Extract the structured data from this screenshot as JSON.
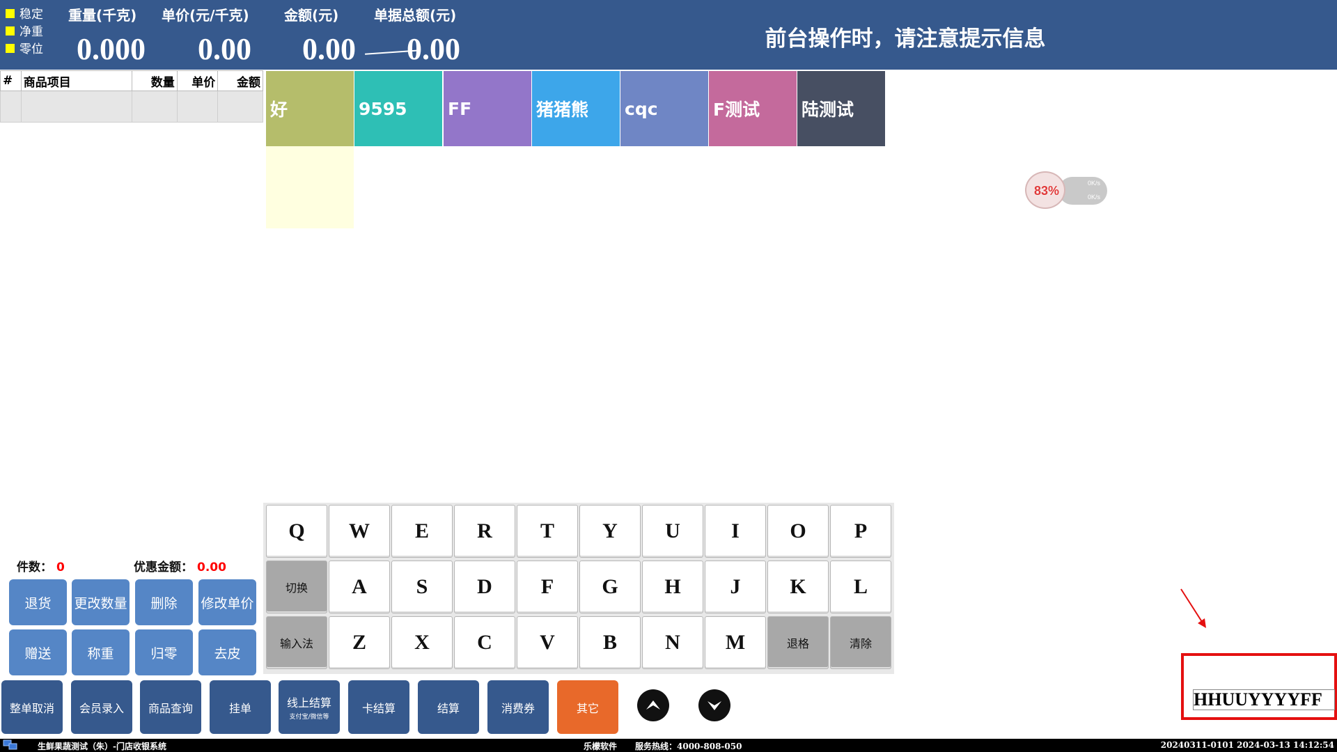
{
  "header": {
    "indicators": [
      "稳定",
      "净重",
      "零位"
    ],
    "indicator_color": "#ffff00",
    "labels": {
      "weight": "重量(千克)",
      "unit_price": "单价(元/千克)",
      "amount": "金额(元)",
      "total": "单据总额(元)"
    },
    "values": {
      "weight": "0.000",
      "unit_price": "0.00",
      "amount": "0.00",
      "total": "0.00"
    },
    "notice": "前台操作时，请注意提示信息",
    "background": "#36598d"
  },
  "order_table": {
    "columns": [
      "#",
      "商品项目",
      "数量",
      "单价",
      "金额"
    ],
    "rows": []
  },
  "categories": [
    {
      "label": "好",
      "color": "#b5bd6b"
    },
    {
      "label": "9595",
      "color": "#2ebfb5"
    },
    {
      "label": "FF",
      "color": "#9376c9"
    },
    {
      "label": "猪猪熊",
      "color": "#3da6ea"
    },
    {
      "label": "cqc",
      "color": "#6f86c5"
    },
    {
      "label": "F测试",
      "color": "#c46a9c"
    },
    {
      "label": "陆测试",
      "color": "#474f62"
    }
  ],
  "widget": {
    "percent": "83%",
    "upload": "0K/s",
    "download": "0K/s",
    "icons": [
      "cpu-ball-icon"
    ]
  },
  "keyboard": {
    "row1": [
      "Q",
      "W",
      "E",
      "R",
      "T",
      "Y",
      "U",
      "I",
      "O",
      "P"
    ],
    "row2": [
      "切换",
      "A",
      "S",
      "D",
      "F",
      "G",
      "H",
      "J",
      "K",
      "L"
    ],
    "row3": [
      "输入法",
      "Z",
      "X",
      "C",
      "V",
      "B",
      "N",
      "M",
      "退格",
      "清除"
    ]
  },
  "stats": {
    "count_label": "件数：",
    "count_value": "0",
    "discount_label": "优惠金额：",
    "discount_value": "0.00"
  },
  "function_buttons": {
    "row1": [
      "退货",
      "更改数量",
      "删除",
      "修改单价"
    ],
    "row2": [
      "赠送",
      "称重",
      "归零",
      "去皮"
    ]
  },
  "bottom_buttons": [
    {
      "label": "整单取消",
      "sub": ""
    },
    {
      "label": "会员录入",
      "sub": ""
    },
    {
      "label": "商品查询",
      "sub": ""
    },
    {
      "label": "挂单",
      "sub": ""
    },
    {
      "label": "线上结算",
      "sub": "支付宝/微信等"
    },
    {
      "label": "卡结算",
      "sub": ""
    },
    {
      "label": "结算",
      "sub": ""
    },
    {
      "label": "消费券",
      "sub": ""
    },
    {
      "label": "其它",
      "sub": "",
      "color": "#e8692a"
    }
  ],
  "nav_icons": [
    "chevron-up-icon",
    "chevron-down-icon"
  ],
  "input": {
    "value": "HHUUYYYYFF"
  },
  "statusbar": {
    "app": "生鲜果蔬测试（朱）-门店收银系统",
    "vendor": "乐檬软件",
    "hotline": "服务热线：4000-808-050",
    "session": "20240311-0101 2024-03-13 14:12:54",
    "icons": [
      "network-icon"
    ]
  }
}
